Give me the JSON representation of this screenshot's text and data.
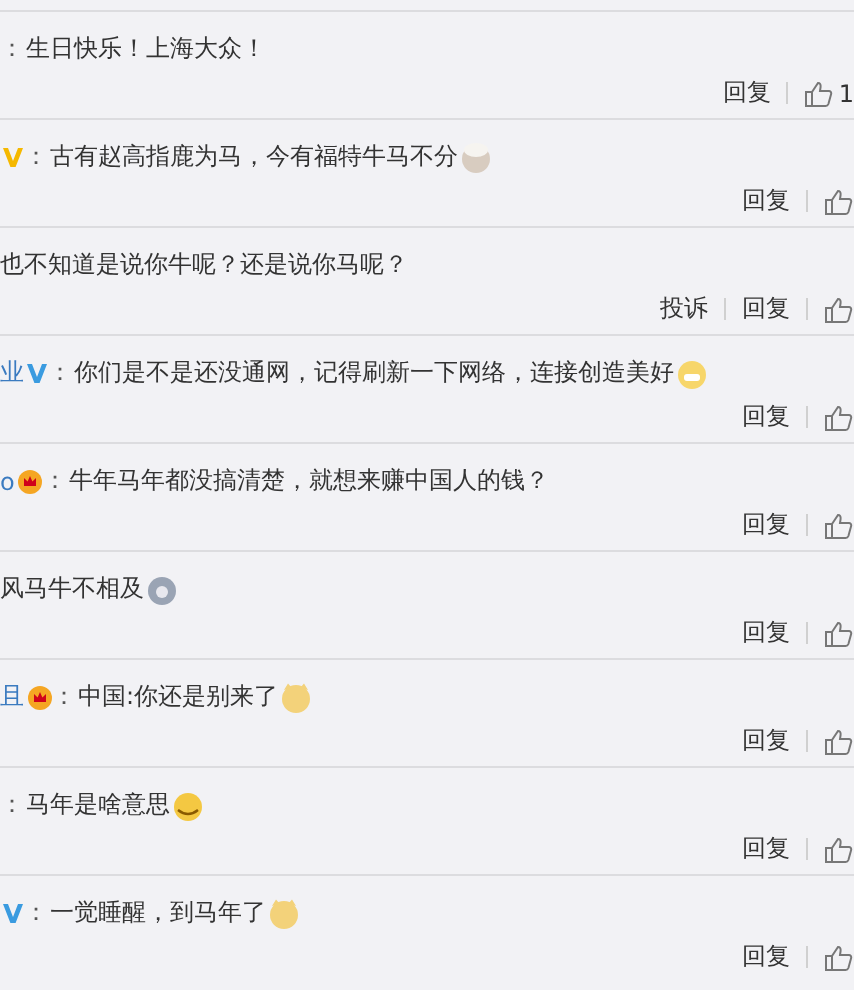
{
  "comments": [
    {
      "colon": "：",
      "text": "生日快乐！上海大众！",
      "actions": [
        "回复"
      ],
      "like_count": "1"
    },
    {
      "badge": {
        "kind": "verified-gold"
      },
      "colon": "：",
      "text": "古有赵高指鹿为马，今有福特牛马不分",
      "emoji": {
        "kind": "chef"
      },
      "actions": [
        "回复"
      ]
    },
    {
      "text": "也不知道是说你牛呢？还是说你马呢？",
      "actions": [
        "投诉",
        "回复"
      ]
    },
    {
      "name": "业",
      "badge": {
        "kind": "verified-blue"
      },
      "colon": "：",
      "text": "你们是不是还没通网，记得刷新一下网络，连接创造美好",
      "emoji": {
        "kind": "grin"
      },
      "actions": [
        "回复"
      ]
    },
    {
      "name": "o",
      "badge": {
        "kind": "crown"
      },
      "colon": "：",
      "text": "牛年马年都没搞清楚，就想来赚中国人的钱？",
      "actions": [
        "回复"
      ]
    },
    {
      "text": "风马牛不相及",
      "emoji": {
        "kind": "gray"
      },
      "actions": [
        "回复"
      ]
    },
    {
      "name": "且",
      "badge": {
        "kind": "crown"
      },
      "colon": "：",
      "text": "中国:你还是别来了",
      "emoji": {
        "kind": "cat"
      },
      "actions": [
        "回复"
      ]
    },
    {
      "colon": "：",
      "text": "马年是啥意思",
      "emoji": {
        "kind": "dizzy"
      },
      "actions": [
        "回复"
      ]
    },
    {
      "badge": {
        "kind": "verified-blue"
      },
      "colon": "：",
      "text": "一觉睡醒，到马年了",
      "emoji": {
        "kind": "cat"
      },
      "actions": [
        "回复"
      ]
    }
  ]
}
